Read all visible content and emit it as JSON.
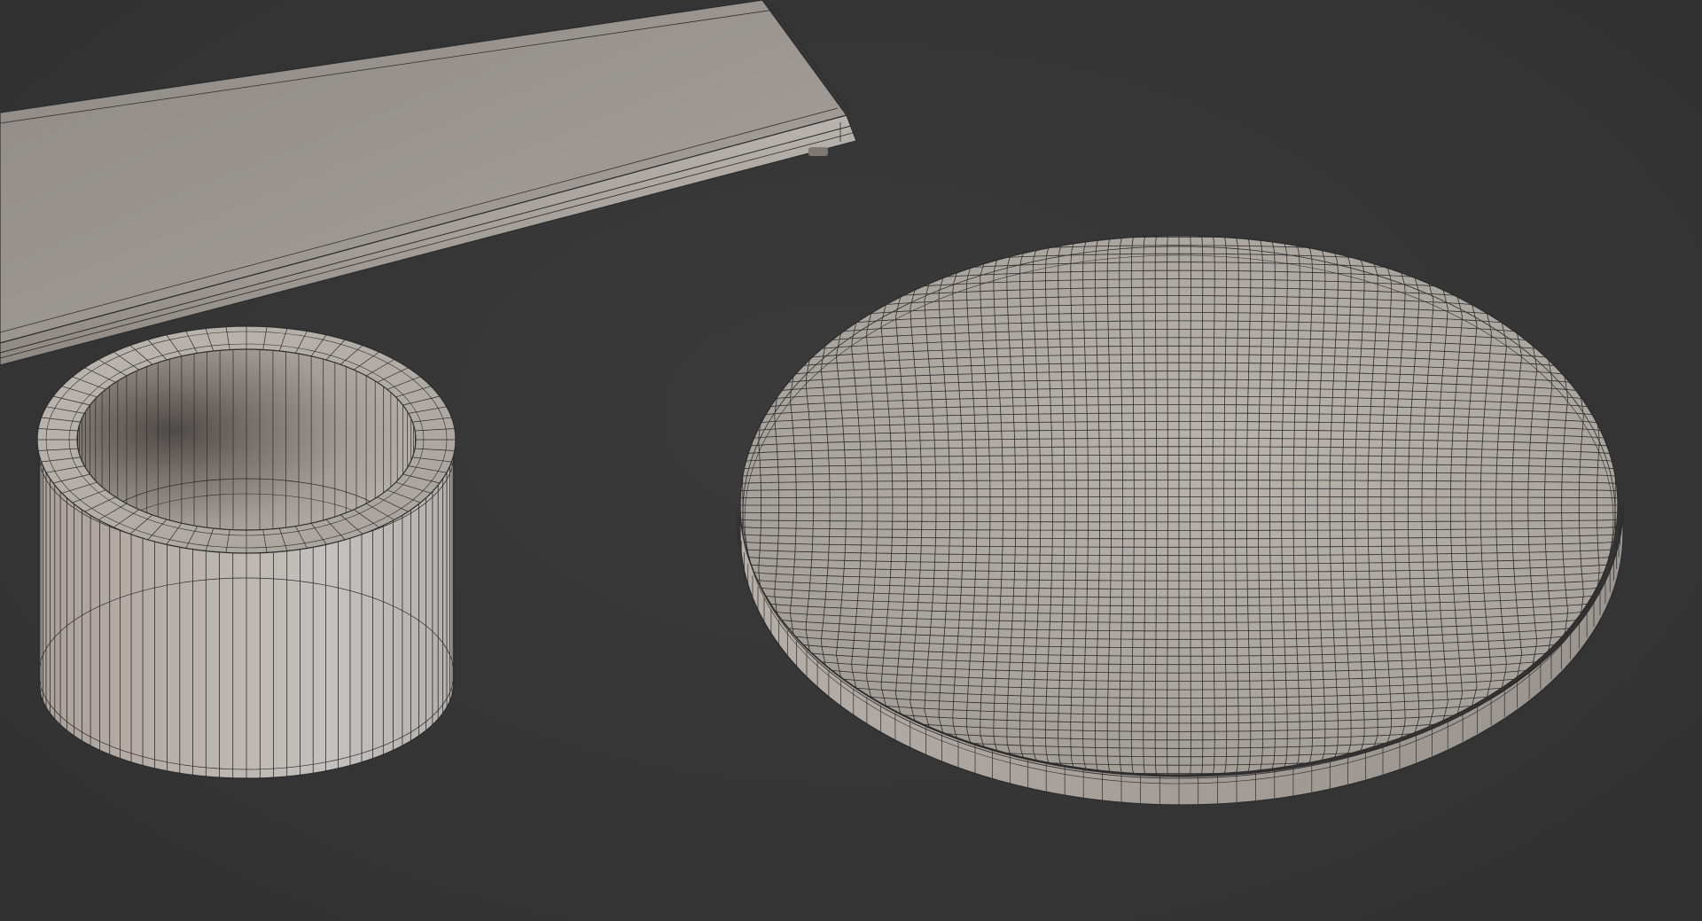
{
  "viewport": {
    "background": "#363636",
    "shading": "solid",
    "overlay": "wireframe"
  },
  "colors": {
    "mesh_surface": "#a9a29c",
    "mesh_light": "#c7c3bf",
    "mesh_shadow": "#6e6762",
    "wire": "#2c2c2c"
  },
  "objects": [
    {
      "name": "board",
      "type": "box",
      "wireframe": true
    },
    {
      "name": "ring",
      "type": "tube",
      "wireframe": true
    },
    {
      "name": "dish",
      "type": "disc",
      "wireframe": true
    }
  ]
}
